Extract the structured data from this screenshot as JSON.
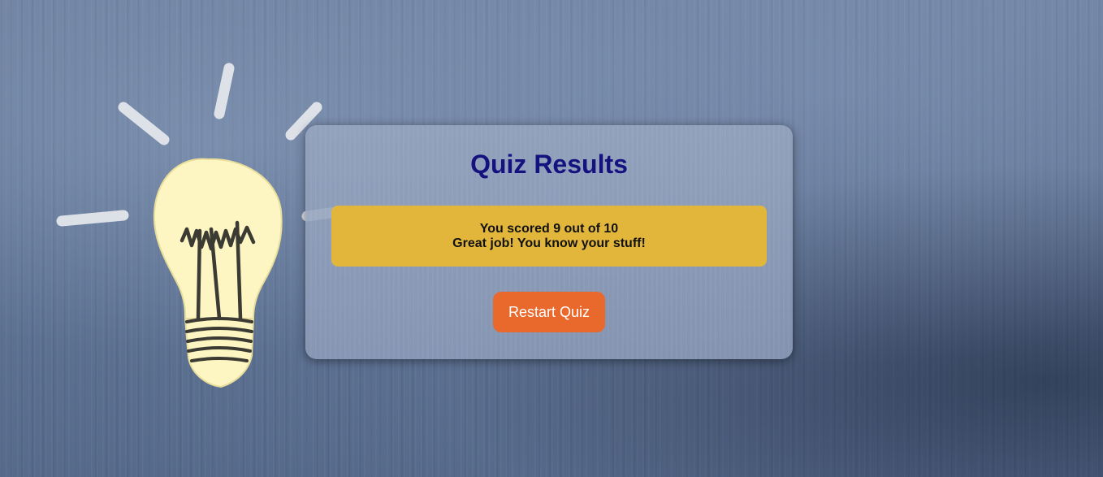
{
  "results": {
    "title": "Quiz Results",
    "score_line": "You scored 9 out of 10",
    "message": "Great job! You know your stuff!",
    "restart_label": "Restart Quiz"
  },
  "colors": {
    "title": "#15127f",
    "score_box": "#e2b63b",
    "restart_button": "#e9692d"
  },
  "background": {
    "illustration": "lightbulb-icon"
  }
}
